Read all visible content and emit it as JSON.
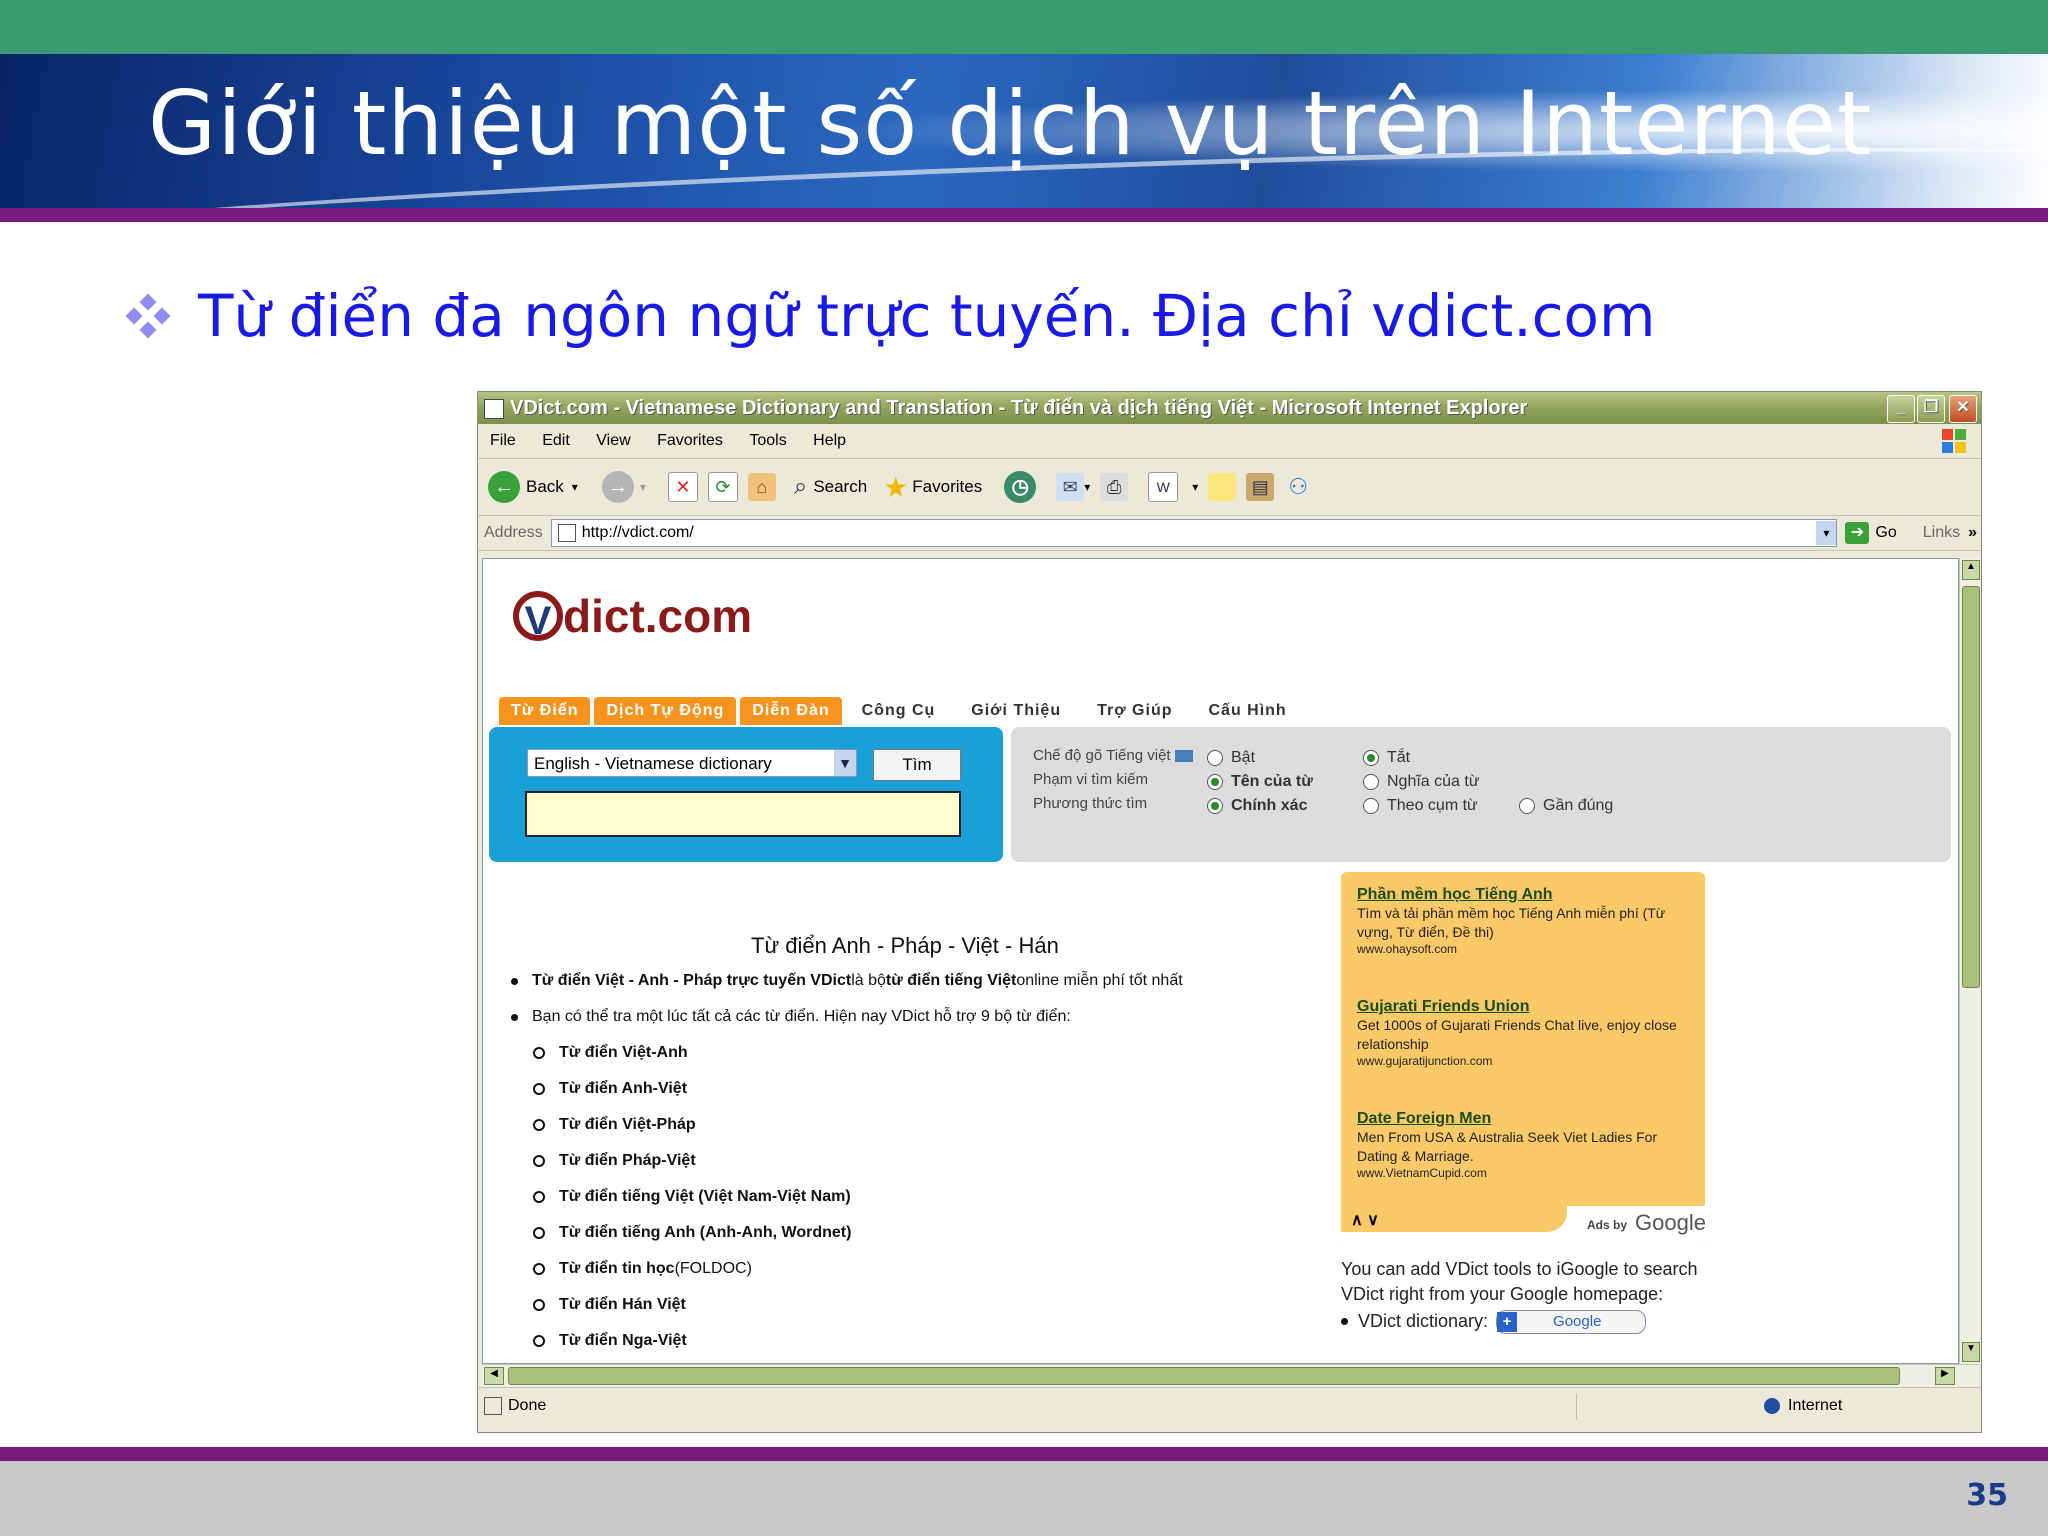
{
  "slide": {
    "title": "Giới thiệu một số dịch vụ trên Internet",
    "bullet": "Từ điển đa ngôn ngữ trực tuyến. Địa chỉ vdict.com",
    "page_number": "35"
  },
  "browser": {
    "title": "VDict.com - Vietnamese Dictionary and Translation - Từ điển và dịch tiếng Việt - Microsoft Internet Explorer",
    "menu": [
      "File",
      "Edit",
      "View",
      "Favorites",
      "Tools",
      "Help"
    ],
    "toolbar": {
      "back": "Back",
      "search": "Search",
      "favorites": "Favorites"
    },
    "address_label": "Address",
    "address_value": "http://vdict.com/",
    "go_label": "Go",
    "links_label": "Links",
    "status_left": "Done",
    "status_zone": "Internet"
  },
  "page": {
    "logo_v": "V",
    "logo_text": "dict.com",
    "tabs": [
      "Từ Điển",
      "Dịch Tự Động",
      "Diễn Đàn",
      "Công Cụ",
      "Giới Thiệu",
      "Trợ Giúp",
      "Cấu Hình"
    ],
    "dictionary_select": "English - Vietnamese dictionary",
    "search_button": "Tìm",
    "options": {
      "typing_mode_label": "Chế độ gõ Tiếng việt",
      "scope_label": "Phạm vi tìm kiếm",
      "method_label": "Phương thức tìm",
      "on": "Bật",
      "off": "Tắt",
      "word_name": "Tên của từ",
      "word_meaning": "Nghĩa của từ",
      "exact": "Chính xác",
      "phrase": "Theo cụm từ",
      "approximate": "Gần đúng"
    },
    "heading": "Từ điển Anh - Pháp - Việt - Hán",
    "intro_bold": "Từ điển Việt - Anh - Pháp trực tuyến VDict",
    "intro_mid": " là bộ ",
    "intro_bold2": "từ điển tiếng Việt",
    "intro_end": " online miễn phí tốt nhất",
    "intro2": "Bạn có thể tra một lúc tất cả các từ điển. Hiện nay VDict hỗ trợ 9 bộ từ điển:",
    "dictionaries": [
      "Từ điển Việt-Anh",
      "Từ điển Anh-Việt",
      "Từ điển Việt-Pháp",
      "Từ điển Pháp-Việt",
      "Từ điển tiếng Việt (Việt Nam-Việt Nam)",
      "Từ điển tiếng Anh (Anh-Anh, Wordnet)",
      "Từ điển tin học",
      "Từ điển Hán Việt",
      "Từ điển Nga-Việt"
    ],
    "foldoc": " (FOLDOC)",
    "ads": [
      {
        "title": "Phần mềm học Tiếng Anh",
        "desc": "Tìm và tải phần mềm học Tiếng Anh miễn phí (Từ vựng, Từ điển, Đề thi)",
        "url": "www.ohaysoft.com"
      },
      {
        "title": "Gujarati Friends Union",
        "desc": "Get 1000s of Gujarati Friends Chat live, enjoy close relationship",
        "url": "www.gujaratijunction.com"
      },
      {
        "title": "Date Foreign Men",
        "desc": "Men From USA & Australia Seek Viet Ladies For Dating & Marriage.",
        "url": "www.VietnamCupid.com"
      }
    ],
    "ads_nav": "∧ ∨",
    "ads_by": "Ads by",
    "google": "Google",
    "tools_text": "You can add VDict tools to iGoogle to search VDict right from your Google homepage:",
    "tools_item": "VDict dictionary:"
  },
  "colors": {
    "banner_top": "#3a9b73",
    "accent_purple": "#7b1b7e",
    "bullet_text": "#1a1ae6",
    "tab_orange": "#f7941d",
    "search_blue": "#1aa0d8",
    "ads_bg": "#fcc968"
  }
}
